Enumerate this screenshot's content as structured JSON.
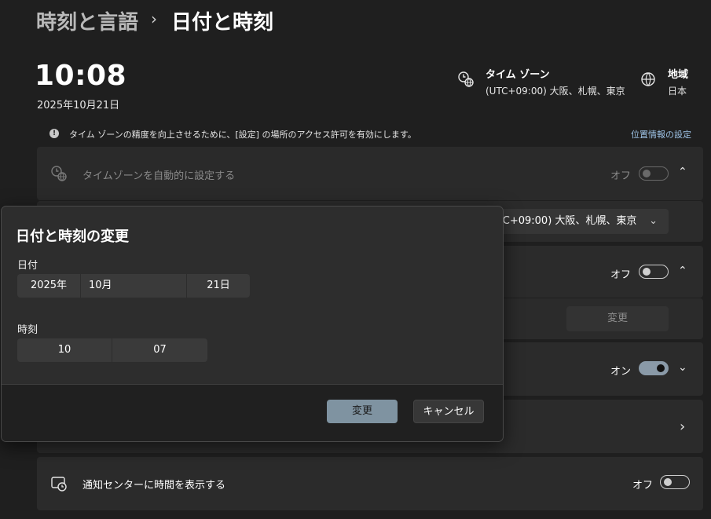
{
  "breadcrumb": {
    "parent": "時刻と言語",
    "separator": "›",
    "current": "日付と時刻"
  },
  "clock": {
    "time": "10:08",
    "date": "2025年10月21日"
  },
  "timezone_info": {
    "title": "タイム ゾーン",
    "value": "(UTC+09:00) 大阪、札幌、東京"
  },
  "region_info": {
    "title": "地域",
    "value": "日本"
  },
  "notice": {
    "text": "タイム ゾーンの精度を向上させるために、[設定] の場所のアクセス許可を有効にします。",
    "link": "位置情報の設定"
  },
  "auto_timezone": {
    "label": "タイムゾーンを自動的に設定する",
    "state": "オフ"
  },
  "timezone_select": {
    "value": "(UTC+09:00) 大阪、札幌、東京"
  },
  "auto_time": {
    "state": "オフ",
    "button": "変更"
  },
  "daylight": {
    "state": "オン"
  },
  "notification_center": {
    "label": "通知センターに時間を表示する",
    "state": "オフ"
  },
  "dialog": {
    "title": "日付と時刻の変更",
    "date_label": "日付",
    "year": "2025年",
    "month": "10月",
    "day": "21日",
    "time_label": "時刻",
    "hour": "10",
    "minute": "07",
    "primary_button": "変更",
    "cancel_button": "キャンセル"
  },
  "colors": {
    "accent": "#7f93a1",
    "toggle_on": "#8a9aa8",
    "link": "#9ec3e6",
    "background": "#1f1f1f"
  }
}
